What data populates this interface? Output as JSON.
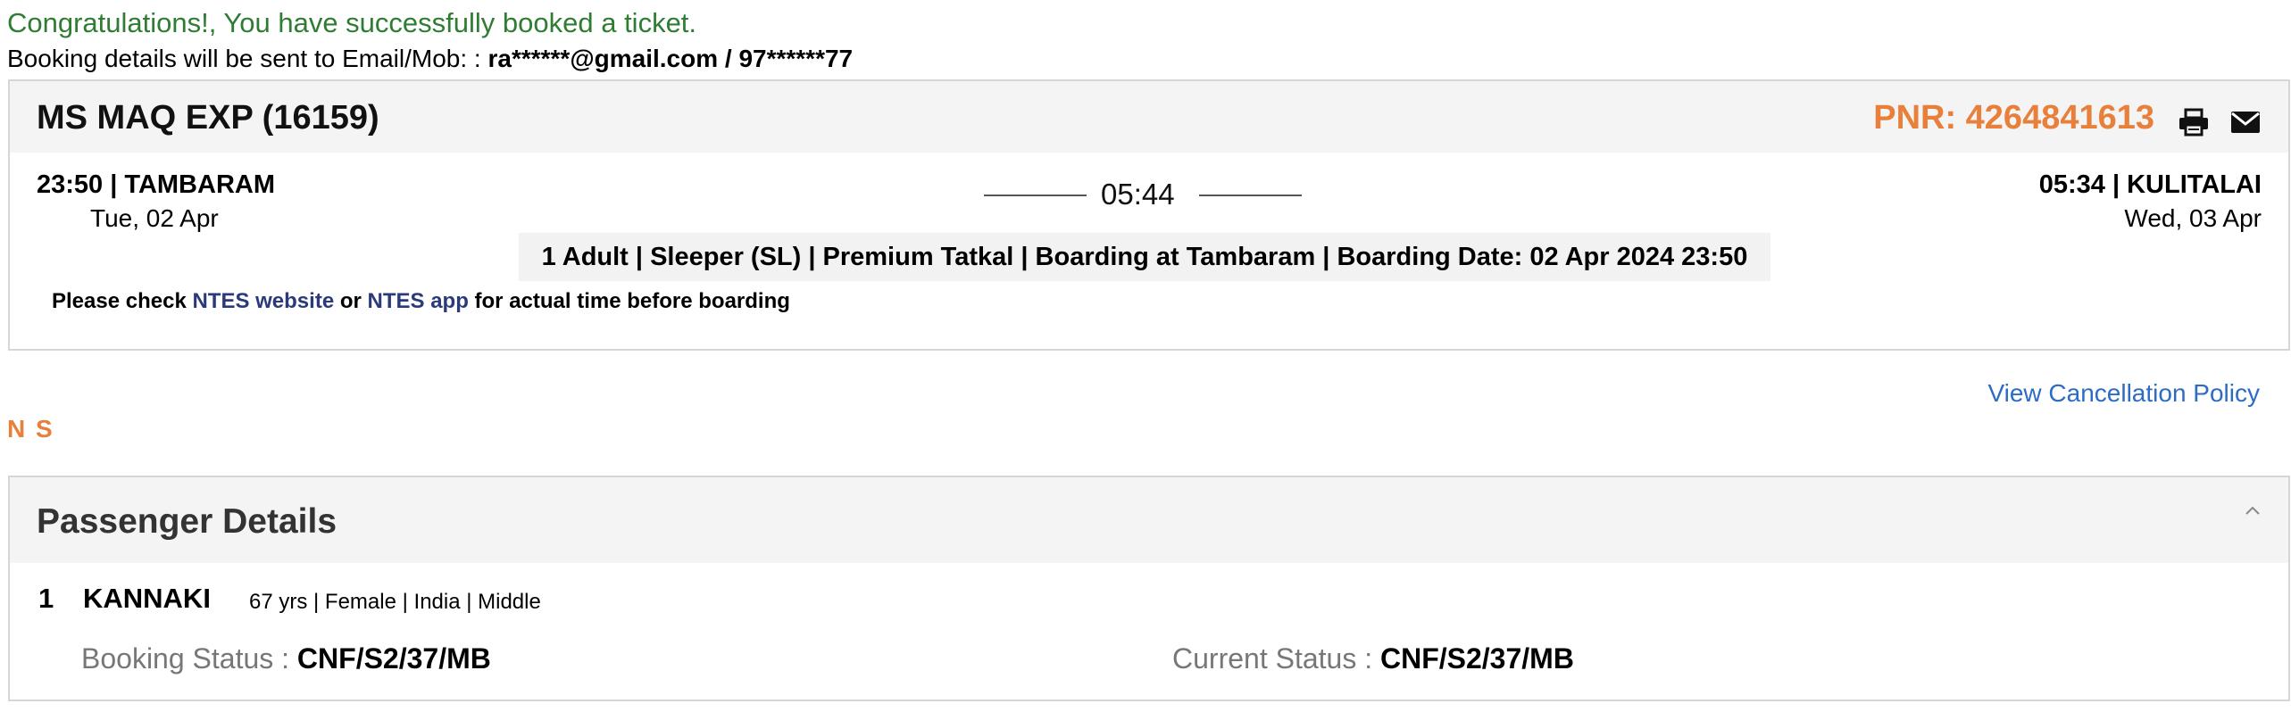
{
  "header": {
    "congrats": "Congratulations!, You have successfully booked a ticket.",
    "sent_prefix": "Booking details will be sent to Email/Mob: : ",
    "contact": "ra******@gmail.com / 97******77"
  },
  "journey": {
    "train_name": "MS MAQ EXP (16159)",
    "pnr": "PNR: 4264841613",
    "from_station": "23:50 | TAMBARAM",
    "from_date": "Tue, 02 Apr",
    "duration": "05:44",
    "to_station": "05:34 | KULITALAI",
    "to_date": "Wed, 03 Apr",
    "class_info": "1 Adult | Sleeper (SL) | Premium Tatkal | Boarding at Tambaram | Boarding Date: 02 Apr 2024 23:50",
    "check_prefix": "Please check ",
    "ntes_website": "NTES website",
    "check_or": " or ",
    "ntes_app": "NTES app",
    "check_suffix": " for actual time before boarding"
  },
  "cancellation_policy": "View Cancellation Policy",
  "ns_tag": "N S",
  "passengers": {
    "title": "Passenger Details",
    "list": [
      {
        "index": "1",
        "name": "KANNAKI",
        "meta": "67 yrs | Female | India | Middle",
        "booking_label": "Booking Status : ",
        "booking_value": "CNF/S2/37/MB",
        "current_label": "Current Status : ",
        "current_value": "CNF/S2/37/MB"
      }
    ]
  },
  "colors": {
    "success_green": "#2e7d32",
    "pnr_orange": "#e8803b",
    "link_blue": "#2b6cc4",
    "ntes_navy": "#2a3a7a"
  },
  "icons": {
    "print": "print-icon",
    "mail": "mail-icon",
    "collapse": "chevron-up-icon"
  }
}
